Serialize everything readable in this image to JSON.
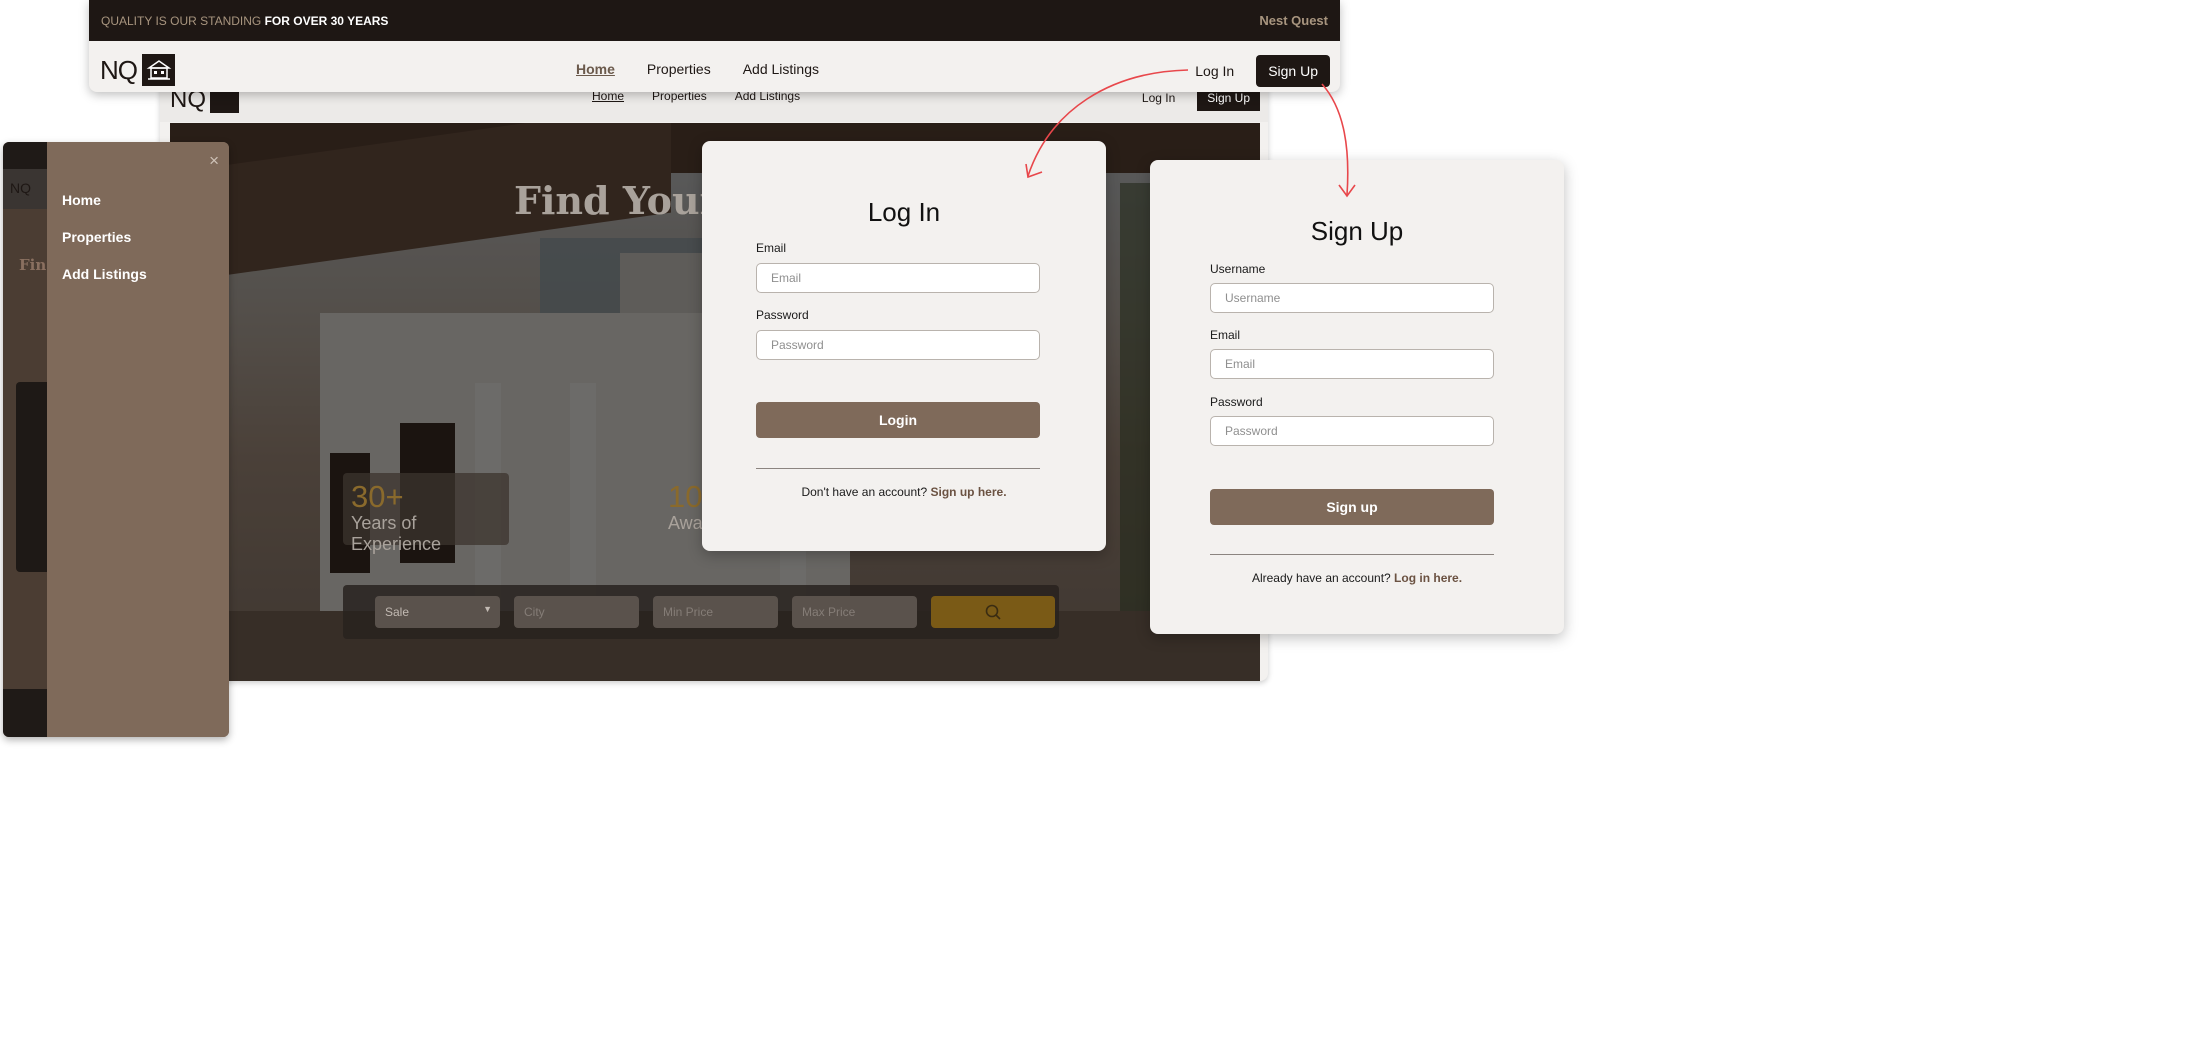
{
  "header": {
    "promo_dim": "QUALITY IS OUR STANDING",
    "promo_bright": "FOR OVER 30 YEARS",
    "brand": "Nest Quest",
    "logo_text": "NQ",
    "nav": [
      "Home",
      "Properties",
      "Add Listings"
    ],
    "login_label": "Log In",
    "signup_label": "Sign Up"
  },
  "background_site": {
    "logo_text": "NQ",
    "nav": [
      "Home",
      "Properties",
      "Add Listings"
    ],
    "login_label": "Log In",
    "signup_label": "Sign Up",
    "hero_title": "Find Your I",
    "stats": [
      {
        "number": "30+",
        "label": "Years of Experience"
      },
      {
        "number": "10",
        "label": "Awa"
      }
    ],
    "search": {
      "type_value": "Sale",
      "city_placeholder": "City",
      "min_price_placeholder": "Min Price",
      "max_price_placeholder": "Max Price"
    }
  },
  "drawer": {
    "strip_logo": "NQ",
    "strip_text": "Fin",
    "items": [
      "Home",
      "Properties",
      "Add Listings"
    ],
    "close_icon": "×"
  },
  "login": {
    "title": "Log In",
    "email_label": "Email",
    "email_placeholder": "Email",
    "password_label": "Password",
    "password_placeholder": "Password",
    "submit": "Login",
    "switch_text": "Don't have an account?",
    "switch_link": "Sign up here."
  },
  "signup": {
    "title": "Sign Up",
    "username_label": "Username",
    "username_placeholder": "Username",
    "email_label": "Email",
    "email_placeholder": "Email",
    "password_label": "Password",
    "password_placeholder": "Password",
    "submit": "Sign up",
    "switch_text": "Already have an account?",
    "switch_link": "Log in here."
  },
  "colors": {
    "dark": "#1e1714",
    "brown": "#7f6a5a",
    "accent_gold": "#7a5a16",
    "arrow_red": "#e8474b",
    "panel_bg": "#f3f1ef"
  },
  "icons": [
    "house-logo-icon",
    "close-icon",
    "search-icon",
    "chevron-down-icon"
  ]
}
